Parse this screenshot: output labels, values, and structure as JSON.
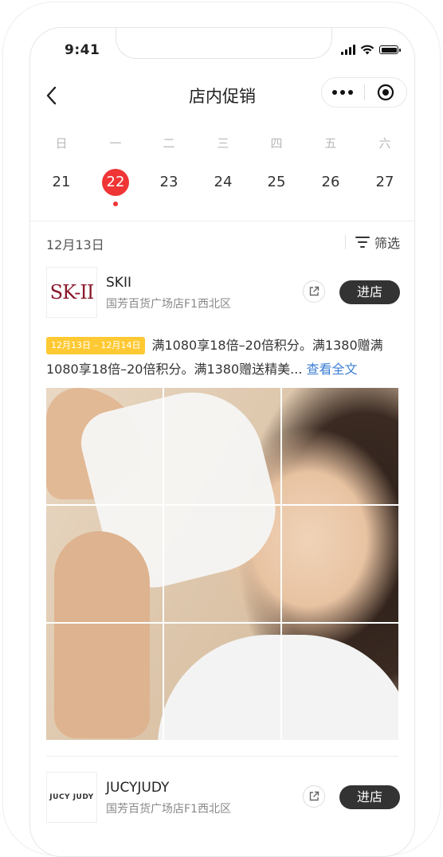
{
  "status_bar": {
    "time": "9:41"
  },
  "nav": {
    "title": "店内促销"
  },
  "calendar": {
    "weekdays": [
      "日",
      "一",
      "二",
      "三",
      "四",
      "五",
      "六"
    ],
    "dates": [
      "21",
      "22",
      "23",
      "24",
      "25",
      "26",
      "27"
    ],
    "selected": "22"
  },
  "list_header": {
    "date": "12月13日",
    "filter_label": "筛选"
  },
  "stores": [
    {
      "logo_text": "SK-II",
      "name": "SKII",
      "address": "国芳百货广场店F1西北区",
      "enter_label": "进店",
      "promo_tag": "12月13日 – 12月14日",
      "promo_text": "满1080享18倍–20倍积分。满1380赠满1080享18倍–20倍积分。满1380赠送精美...",
      "read_more": "查看全文"
    },
    {
      "logo_text": "JUCY JUDY",
      "name": "JUCYJUDY",
      "address": "国芳百货广场店F1西北区",
      "enter_label": "进店"
    }
  ],
  "colors": {
    "accent_red": "#ef3535",
    "tag_yellow": "#ffc933",
    "link_blue": "#3d7fd6",
    "button_dark": "#333333"
  }
}
